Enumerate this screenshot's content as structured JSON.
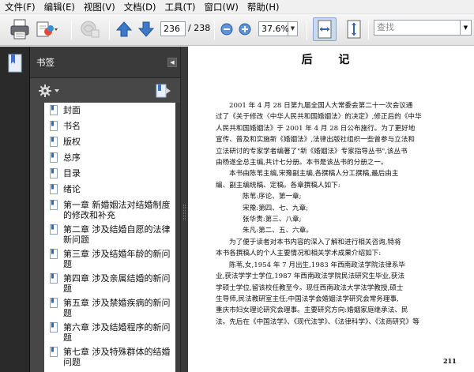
{
  "menubar": {
    "items": [
      "文件(F)",
      "编辑(E)",
      "视图(V)",
      "文档(D)",
      "工具(T)",
      "窗口(W)",
      "帮助(H)"
    ]
  },
  "toolbar": {
    "page_current": "236",
    "page_total": "/ 238",
    "zoom": "37.6%",
    "search_placeholder": "查找"
  },
  "bookmarks": {
    "title": "书签",
    "items": [
      "封面",
      "书名",
      "版权",
      "总序",
      "目录",
      "绪论",
      "第一章 新婚姻法对结婚制度的修改和补充",
      "第二章 涉及结婚自愿的法律新问题",
      "第三章 涉及结婚年龄的新问题",
      "第四章 涉及亲属结婚的新问题",
      "第五章 涉及禁婚疾病的新问题",
      "第六章 涉及结婚程序的新问题",
      "第七章 涉及特殊群体的结婚问题"
    ]
  },
  "document": {
    "title": "后 记",
    "lines_p1": [
      "2001 年 4 月 28 日第九届全国人大常委会第二十一次会议通",
      "过了《关于修改〈中华人民共和国婚姻法〉的决定》,修正后的《中华",
      "人民共和国婚姻法》于 2001 年 4 月 28 日公布施行。为了更好地",
      "宣传、普及和实施新《婚姻法》,法律出版社组织一些曾参与立法和",
      "立法研讨的专家学者编著了\"新《婚姻法》专家指导丛书\",该丛书",
      "由杨遂全总主编,共计七分册。本书是该丛书的分册之一。"
    ],
    "lines_p2": [
      "本书由陈苇主编,宋豫副主编,各撰稿人分工撰稿,最后由主",
      "编、副主编统稿、定稿。各章撰稿人如下:"
    ],
    "authors": [
      "陈苇:序论、第一章;",
      "宋豫:第四、七、九章;",
      "张华贵:第三、八章;",
      "朱凡:第二、五、六章。"
    ],
    "lines_p3": [
      "为了便于读者对本书内容的深入了解和进行相关咨询,特将",
      "本书各撰稿人的个人主要情况和相关学术成果介绍如下:"
    ],
    "lines_p4": [
      "陈苇,女,1954 年 7 月出生,1983 年西南政法学院法律系毕",
      "业,获法学学士学位,1987 年西南政法学院民法研究生毕业,获法",
      "学硕士学位,留该校任教至今。现任西南政法大学法学教授,硕士",
      "生导师,民法教研室主任;中国法学会婚姻法学研究会常务理事,",
      "重庆市妇女理论研究会理事。主要研究方向:婚姻家庭继承法、民",
      "法。先后在《中国法学》、《现代法学》、《法律科学》、《法商研究》等"
    ],
    "page_number": "211"
  }
}
